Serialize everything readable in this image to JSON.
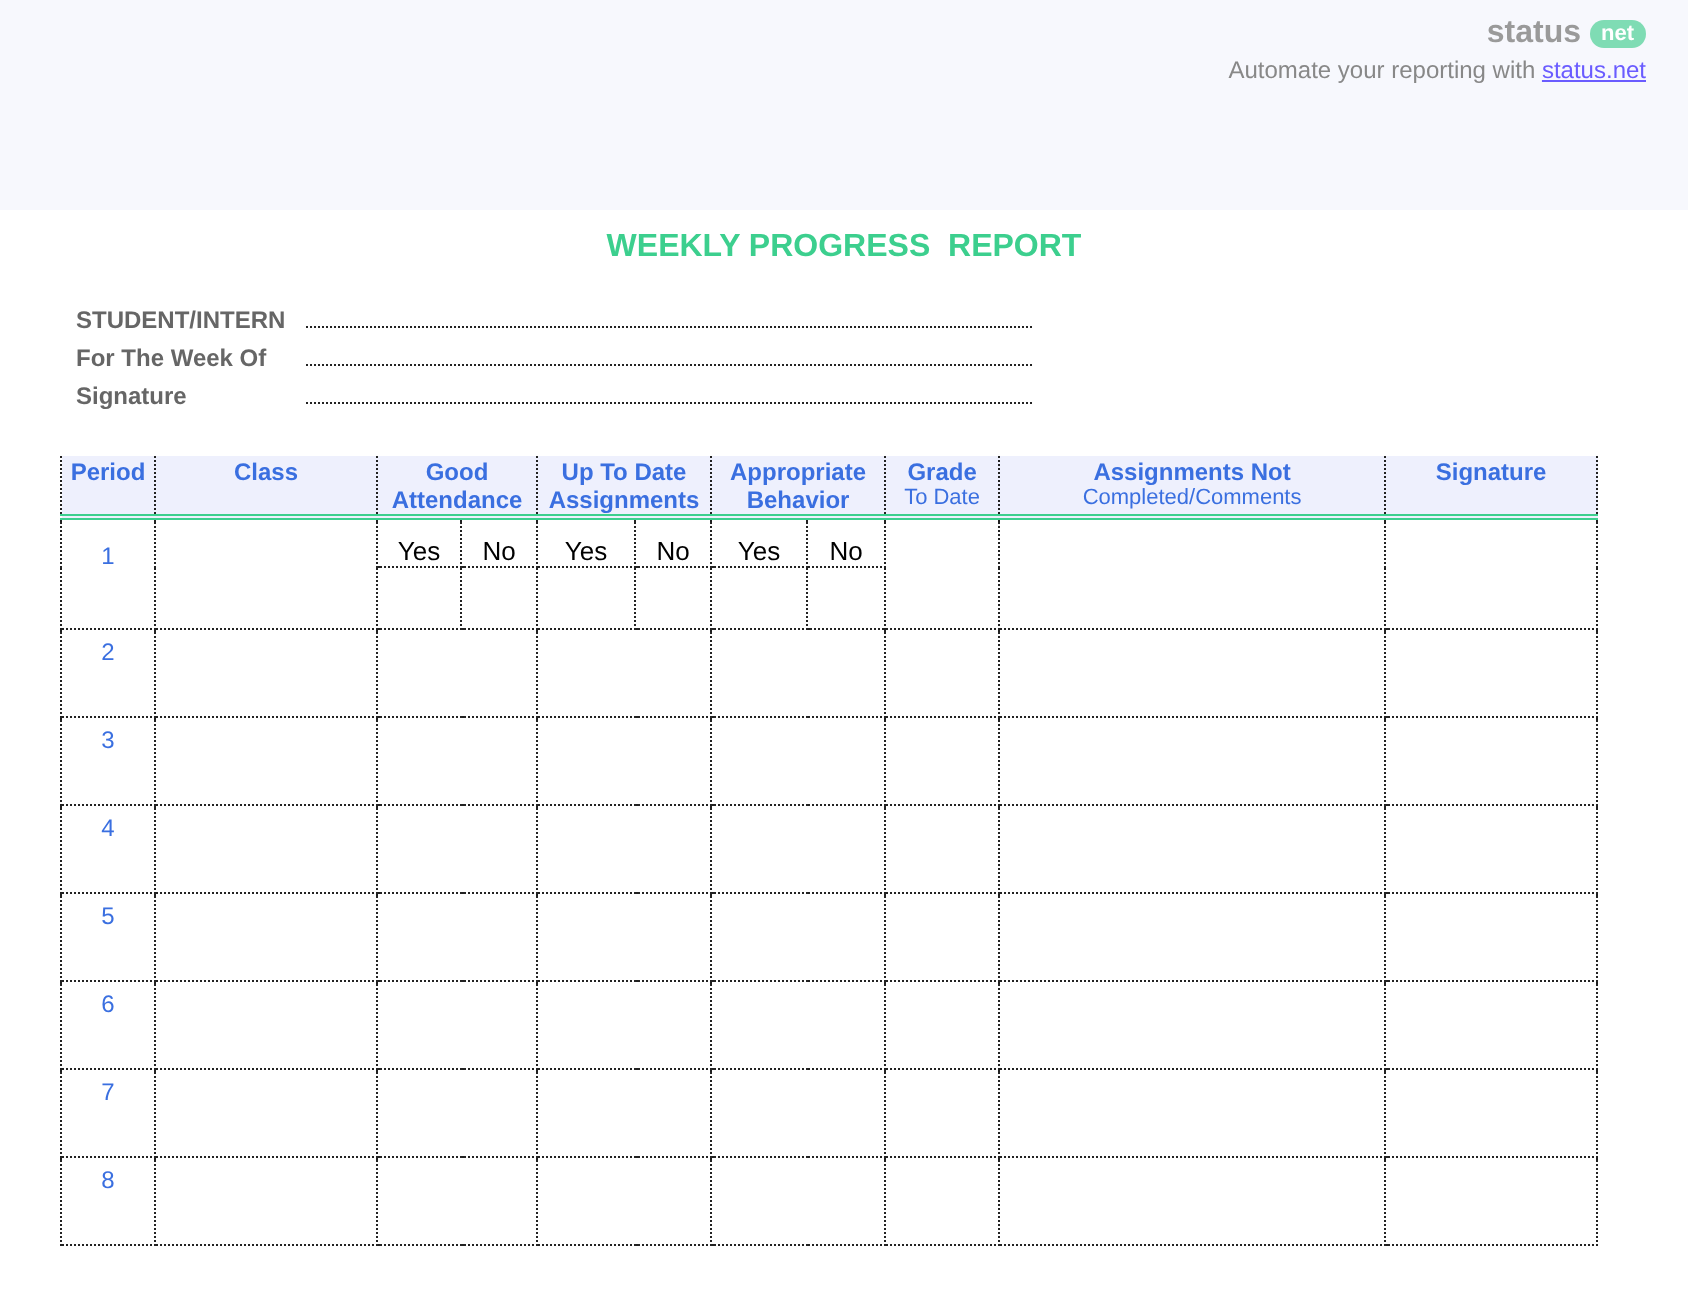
{
  "brand": {
    "logo": "status",
    "logo_badge": "net",
    "tagline": "Automate your reporting with ",
    "link": "status.net"
  },
  "report": {
    "title": "WEEKLY PROGRESS  REPORT",
    "fields": [
      {
        "label": "STUDENT/INTERN"
      },
      {
        "label": "For The Week Of"
      },
      {
        "label": "Signature"
      }
    ],
    "table": {
      "columns": [
        {
          "title": "Period",
          "kind": "single"
        },
        {
          "title": "Class",
          "kind": "single"
        },
        {
          "title": "Good\nAttendance",
          "kind": "yes_no"
        },
        {
          "title": "Up To Date\nAssignments",
          "kind": "yes_no"
        },
        {
          "title": "Appropriate\nBehavior",
          "kind": "yes_no"
        },
        {
          "title": "Grade",
          "subtitle": "To Date",
          "kind": "single"
        },
        {
          "title": "Assignments Not",
          "subtitle": "Completed/Comments",
          "kind": "single"
        },
        {
          "title": "Signature",
          "kind": "single"
        }
      ],
      "rows": [
        {
          "period": "1",
          "options": [
            "Yes",
            "No",
            "Yes",
            "No",
            "Yes",
            "No"
          ]
        },
        {
          "period": "2"
        },
        {
          "period": "3"
        },
        {
          "period": "4"
        },
        {
          "period": "5"
        },
        {
          "period": "6"
        },
        {
          "period": "7"
        },
        {
          "period": "8"
        }
      ]
    }
  }
}
